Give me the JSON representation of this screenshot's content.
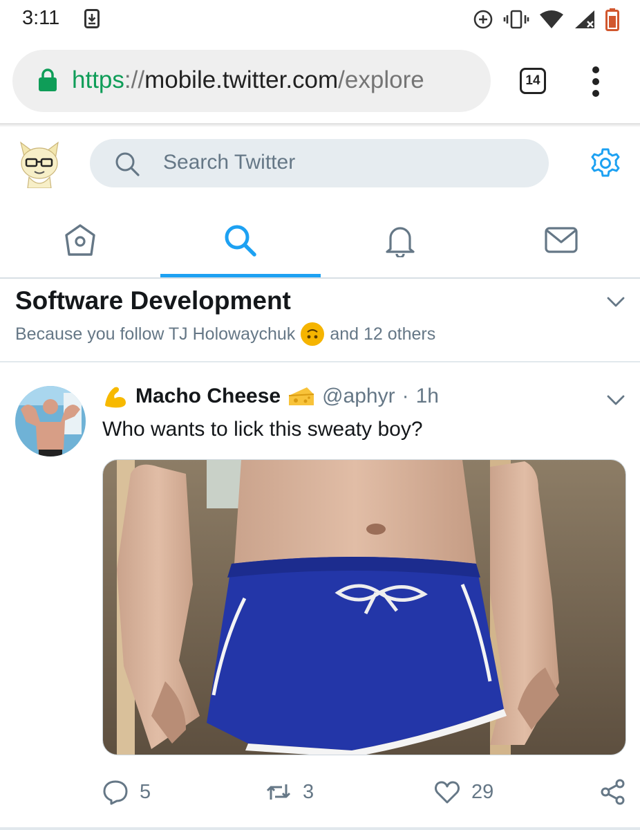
{
  "status_bar": {
    "time": "3:11"
  },
  "browser": {
    "url_scheme": "https",
    "url_separator": "://",
    "url_host": "mobile.twitter.com",
    "url_path": "/explore",
    "tab_count": "14"
  },
  "search": {
    "placeholder": "Search Twitter"
  },
  "nav": {
    "active_tab": "search",
    "tabs": [
      "home",
      "search",
      "notifications",
      "messages"
    ]
  },
  "topic": {
    "title": "Software Development",
    "subtitle_prefix": "Because you follow TJ Holowaychuk",
    "subtitle_suffix": "and 12 others"
  },
  "tweet": {
    "display_name": "Macho Cheese",
    "handle": "@aphyr",
    "separator": "·",
    "time": "1h",
    "text": "Who wants to lick this sweaty boy?",
    "replies": "5",
    "retweets": "3",
    "likes": "29"
  },
  "colors": {
    "twitter_blue": "#1da1f2",
    "secure_green": "#0f9d58",
    "muted_text": "#657786",
    "search_bg": "#e6ecf0"
  }
}
